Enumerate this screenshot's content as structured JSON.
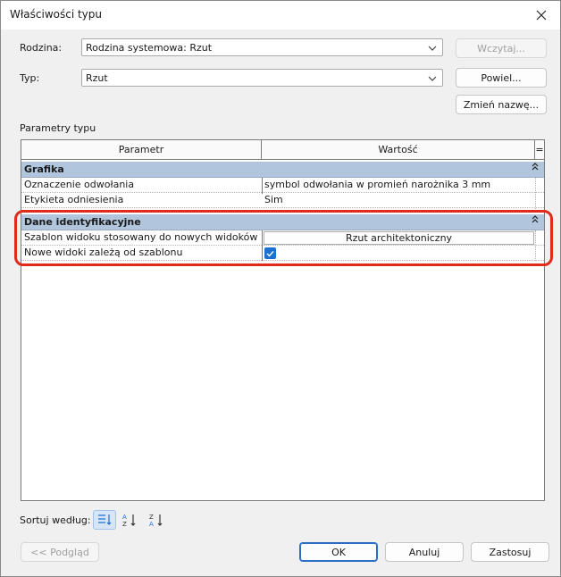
{
  "window": {
    "title": "Właściwości typu"
  },
  "icons": {
    "close": "close-icon",
    "dropdown": "chevron-down-icon",
    "collapse": "double-chevron-up-icon",
    "check": "checkmark-icon"
  },
  "family": {
    "label": "Rodzina:",
    "value": "Rodzina systemowa: Rzut"
  },
  "type": {
    "label": "Typ:",
    "value": "Rzut"
  },
  "buttons": {
    "load": "Wczytaj...",
    "duplicate": "Powiel...",
    "rename": "Zmień nazwę..."
  },
  "params_title": "Parametry typu",
  "grid": {
    "col_param": "Parametr",
    "col_value": "Wartość",
    "col_extra": "=",
    "groups": [
      {
        "name": "Grafika",
        "rows": [
          {
            "param": "Oznaczenie odwołania",
            "value": "symbol odwołania w promień narożnika 3 mm"
          },
          {
            "param": "Etykieta odniesienia",
            "value": "Sim"
          }
        ]
      },
      {
        "name": "Dane identyfikacyjne",
        "rows": [
          {
            "param": "Szablon widoku stosowany do nowych widoków",
            "value": "Rzut architektoniczny"
          },
          {
            "param": "Nowe widoki zależą od szablonu",
            "checked": true
          }
        ]
      }
    ]
  },
  "sort": {
    "label": "Sortuj według:"
  },
  "footer": {
    "preview": "<< Podgląd",
    "ok": "OK",
    "cancel": "Anuluj",
    "apply": "Zastosuj"
  },
  "colors": {
    "group_bg": "#b1c5dd",
    "highlight": "#e12a1a",
    "accent": "#1d6fd2"
  }
}
